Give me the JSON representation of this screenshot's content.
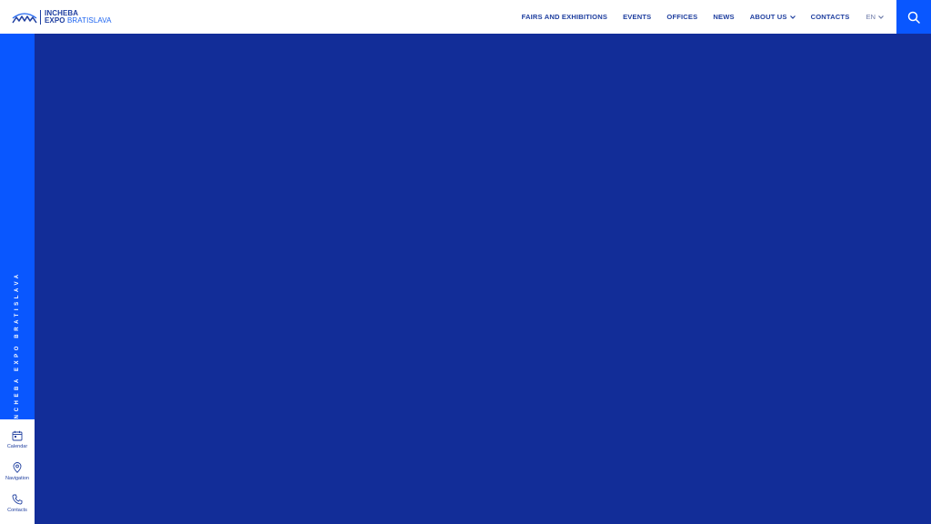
{
  "brand": {
    "line1": "INCHEBA",
    "line2_bold": "EXPO",
    "line2_light": "BRATISLAVA",
    "accent_color": "#0957ff",
    "navy_color": "#1f3f9f",
    "hero_color": "#122d98"
  },
  "nav": {
    "items": [
      {
        "label": "FAIRS AND EXHIBITIONS"
      },
      {
        "label": "EVENTS"
      },
      {
        "label": "OFFICES"
      },
      {
        "label": "NEWS"
      },
      {
        "label": "ABOUT US",
        "has_dropdown": true
      },
      {
        "label": "CONTACTS"
      }
    ],
    "language": "EN",
    "search_icon": "search-icon"
  },
  "sidebar": {
    "vertical_text": "INCHEBA EXPO BRATISLAVA",
    "tools": [
      {
        "label": "Calendar",
        "icon": "calendar-icon"
      },
      {
        "label": "Navigation",
        "icon": "map-pin-icon"
      },
      {
        "label": "Contacts",
        "icon": "phone-icon"
      }
    ]
  }
}
